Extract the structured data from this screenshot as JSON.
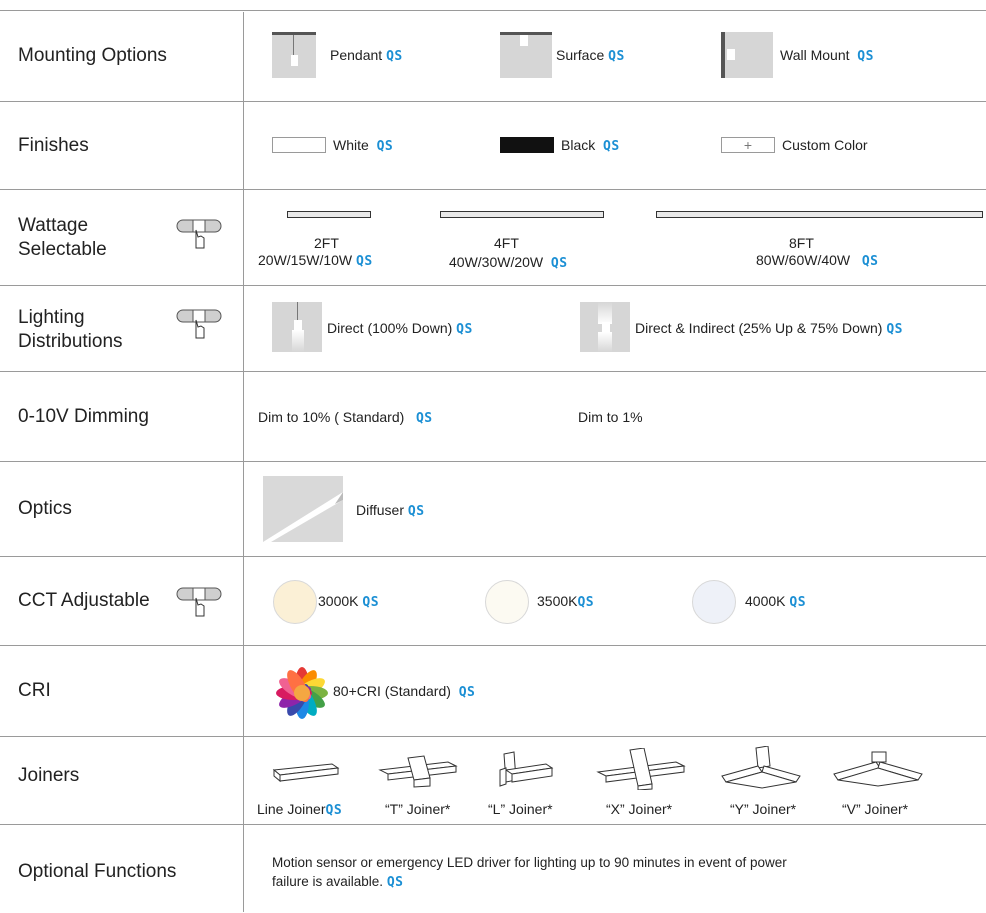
{
  "qs": "QS",
  "rows": {
    "mounting": {
      "label": "Mounting Options",
      "items": [
        {
          "name": "Pendant"
        },
        {
          "name": "Surface"
        },
        {
          "name": "Wall Mount"
        }
      ]
    },
    "finishes": {
      "label": "Finishes",
      "items": [
        {
          "name": "White",
          "color": "#ffffff"
        },
        {
          "name": "Black",
          "color": "#111111"
        },
        {
          "name": "Custom Color",
          "glyph": "+"
        }
      ]
    },
    "wattage": {
      "label_line1": "Wattage",
      "label_line2": "Selectable",
      "items": [
        {
          "length": "2FT",
          "watts": "20W/15W/10W"
        },
        {
          "length": "4FT",
          "watts": "40W/30W/20W"
        },
        {
          "length": "8FT",
          "watts": "80W/60W/40W"
        }
      ]
    },
    "distribution": {
      "label_line1": "Lighting",
      "label_line2": "Distributions",
      "items": [
        {
          "name": "Direct (100% Down)"
        },
        {
          "name": "Direct & Indirect (25% Up & 75% Down)"
        }
      ]
    },
    "dimming": {
      "label": "0-10V Dimming",
      "items": [
        {
          "name": "Dim to 10% ( Standard)"
        },
        {
          "name": "Dim to 1%"
        }
      ]
    },
    "optics": {
      "label": "Optics",
      "items": [
        {
          "name": "Diffuser"
        }
      ]
    },
    "cct": {
      "label": "CCT Adjustable",
      "items": [
        {
          "name": "3000K",
          "color": "#fbf0d6"
        },
        {
          "name": "3500K",
          "color": "#fcfaf2"
        },
        {
          "name": "4000K",
          "color": "#eef1f8"
        }
      ]
    },
    "cri": {
      "label": "CRI",
      "items": [
        {
          "name": "80+CRI (Standard)"
        }
      ]
    },
    "joiners": {
      "label": "Joiners",
      "items": [
        {
          "name": "Line Joiner"
        },
        {
          "name": "“T” Joiner*"
        },
        {
          "name": "“L” Joiner*"
        },
        {
          "name": "“X” Joiner*"
        },
        {
          "name": "“Y” Joiner*"
        },
        {
          "name": "“V” Joiner*"
        }
      ]
    },
    "optional": {
      "label": "Optional Functions",
      "line1": "Motion sensor or emergency LED driver for lighting up to 90 minutes in event of power",
      "line2": "failure is available."
    }
  },
  "colors": {
    "accent": "#1b8fd4",
    "rule": "#9a9a9a"
  }
}
